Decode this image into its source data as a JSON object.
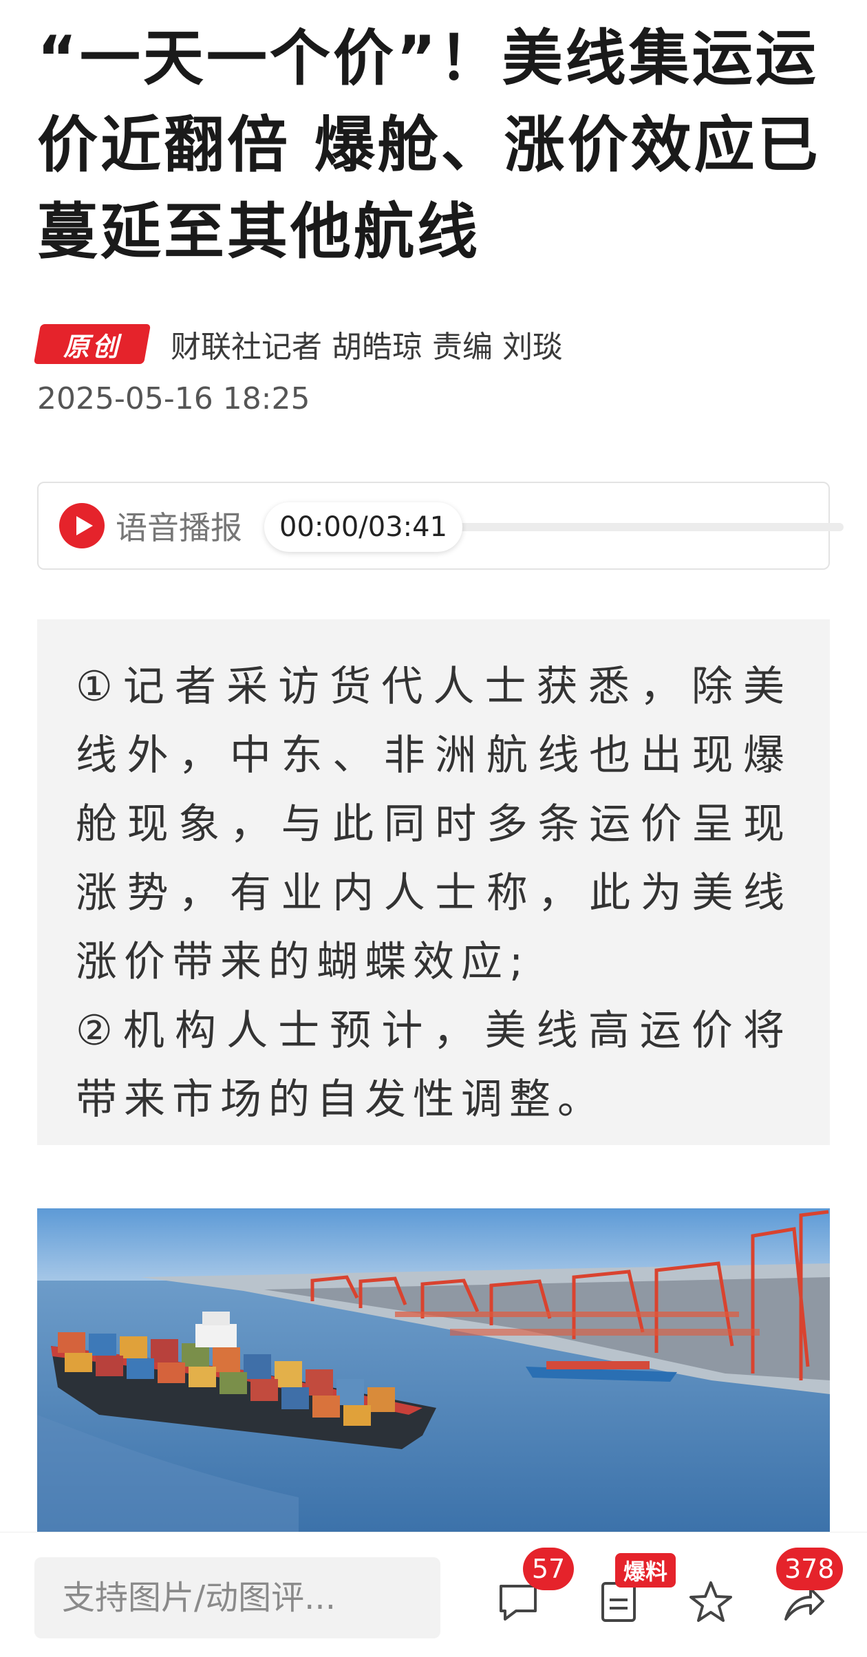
{
  "article": {
    "title": "“一天一个价”！美线集运运价近翻倍 爆舱、涨价效应已蔓延至其他航线",
    "badge": "原创",
    "author_line": "财联社记者 胡皓琼  责编 刘琰",
    "date": "2025-05-16 18:25"
  },
  "audio": {
    "label": "语音播报",
    "time": "00:00/03:41",
    "progress": 0
  },
  "summary": {
    "points": [
      "①记者采访货代人士获悉，除美线外，中东、非洲航线也出现爆舱现象，与此同时多条运价呈现涨势，有业内人士称，此为美线涨价带来的蝴蝶效应;",
      "②机构人士预计，美线高运价将带来市场的自发性调整。"
    ]
  },
  "bottom_bar": {
    "comment_placeholder": "支持图片/动图评...",
    "comment_count": "57",
    "tip_label": "爆料",
    "share_count": "378"
  },
  "colors": {
    "accent": "#e5232b",
    "summary_bg": "#f3f3f3",
    "sea": "#4a86c0"
  },
  "icons": [
    "play-icon",
    "comment-icon",
    "tip-off-icon",
    "star-icon",
    "share-icon"
  ]
}
